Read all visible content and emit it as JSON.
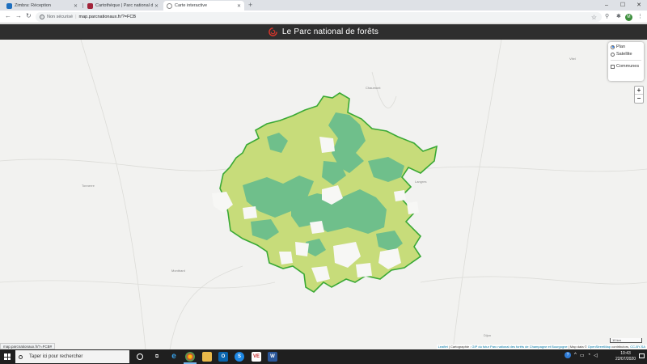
{
  "browser": {
    "tabs": [
      {
        "title": "Zimbra: Réception",
        "favicon_color": "#1e6fbf",
        "active": false
      },
      {
        "title": "Cartothèque | Parc national de fo",
        "favicon_color": "#a2243a",
        "active": false
      },
      {
        "title": "Carte interactive",
        "favicon_color": "#888888",
        "active": true
      }
    ],
    "security_label": "Non sécurisé",
    "url": "map.parcnationaux.fr/?=FCB",
    "profile_initial": "M"
  },
  "site": {
    "title": "Le Parc national de forêts",
    "logo_color": "#d9362b"
  },
  "map": {
    "layer_control": {
      "options": [
        {
          "label": "Plan",
          "selected": true
        },
        {
          "label": "Satellite",
          "selected": false
        }
      ],
      "overlay": {
        "label": "Communes",
        "checked": false
      }
    },
    "zoom_in": "+",
    "zoom_out": "−",
    "scale_label": "10 km",
    "places": [
      "Chaumont",
      "Langres",
      "Vitel",
      "Tonnerre",
      "Montbard",
      "Dijon"
    ],
    "park_colors": {
      "outline": "#3aa935",
      "light": "#c7dc7a",
      "forest": "#6fbf8b"
    },
    "attribution": {
      "leaflet": "Leaflet",
      "text1": " | Cartographie : ",
      "gip": "GIP du futur Parc national des forêts de Champagne et Bourgogne",
      "text2": " | Map data © ",
      "osm": "OpenStreetMap",
      "text3": " contributors, ",
      "license": "CC-BY-SA"
    }
  },
  "status_url": "map.parcnationaux.fr/?=FCB#",
  "taskbar": {
    "search_placeholder": "Taper ici pour rechercher",
    "time": "10:43",
    "date": "22/07/2020"
  }
}
